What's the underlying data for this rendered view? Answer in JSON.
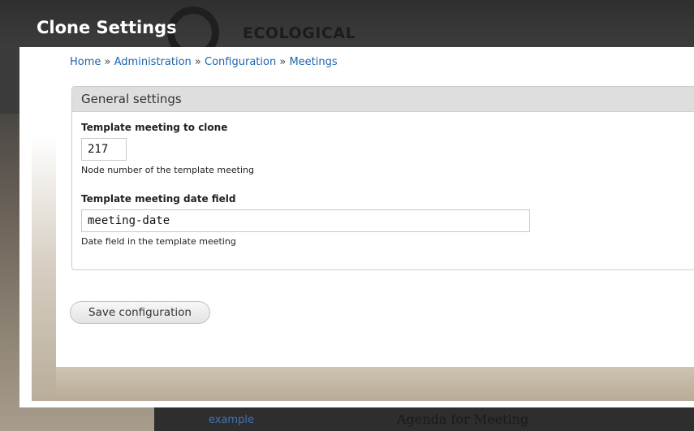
{
  "overlay": {
    "title": "Clone Settings"
  },
  "background_site": {
    "logo_text": "ECOLOGICAL",
    "link_text": "example",
    "heading_text": "Agenda for Meeting"
  },
  "breadcrumb": {
    "items": [
      "Home",
      "Administration",
      "Configuration",
      "Meetings"
    ],
    "separator": "»"
  },
  "fieldset": {
    "legend": "General settings",
    "fields": [
      {
        "label": "Template meeting to clone",
        "value": "217",
        "description": "Node number of the template meeting"
      },
      {
        "label": "Template meeting date field",
        "value": "meeting-date",
        "description": "Date field in the template meeting"
      }
    ]
  },
  "actions": {
    "save_label": "Save configuration"
  },
  "colors": {
    "link": "#1f63ad",
    "legend_bg": "#dedede",
    "overlay_bg": "#3b3b3b"
  }
}
